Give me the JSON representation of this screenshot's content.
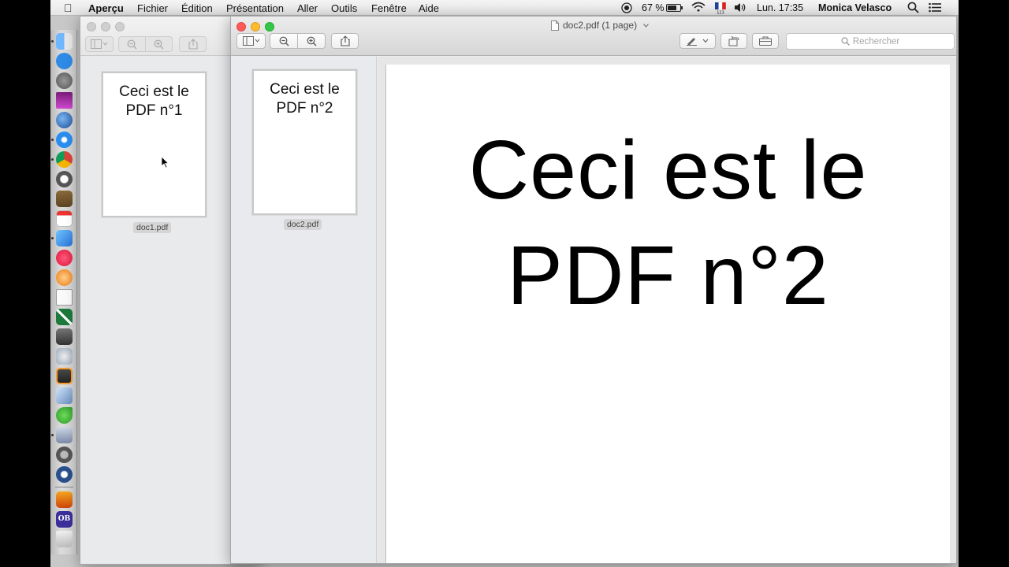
{
  "menubar": {
    "app_name": "Aperçu",
    "items": [
      "Fichier",
      "Édition",
      "Présentation",
      "Aller",
      "Outils",
      "Fenêtre",
      "Aide"
    ],
    "battery": "67 %",
    "clock": "Lun. 17:35",
    "user": "Monica Velasco"
  },
  "window_back": {
    "thumbnail_text_line1": "Ceci est le",
    "thumbnail_text_line2": "PDF n°1",
    "thumbnail_label": "doc1.pdf"
  },
  "window_front": {
    "title": "doc2.pdf (1 page)",
    "search_placeholder": "Rechercher",
    "thumbnail_text_line1": "Ceci est le",
    "thumbnail_text_line2": "PDF n°2",
    "thumbnail_label": "doc2.pdf",
    "page_text_line1": "Ceci est le",
    "page_text_line2": "PDF n°2"
  },
  "colors": {
    "close": "#fc5b57",
    "minimize": "#fdbc2f",
    "zoom": "#33c748"
  },
  "dock_icons": [
    "finder-icon",
    "app-store-icon",
    "launchpad-icon",
    "screen-icon",
    "thunderbird-icon",
    "safari-icon",
    "chrome-icon",
    "pages-icon",
    "notebook-icon",
    "calendar-icon",
    "preview-icon",
    "itunes-icon",
    "ibooks-icon",
    "textedit-icon",
    "excel-icon",
    "scripteditor-icon",
    "automator-icon",
    "sublime-icon",
    "virtualbox-icon",
    "evernote-icon",
    "printer-icon",
    "system-prefs-icon",
    "quicktime-icon",
    "vlc-icon",
    "ob-icon",
    "trash-icon"
  ]
}
